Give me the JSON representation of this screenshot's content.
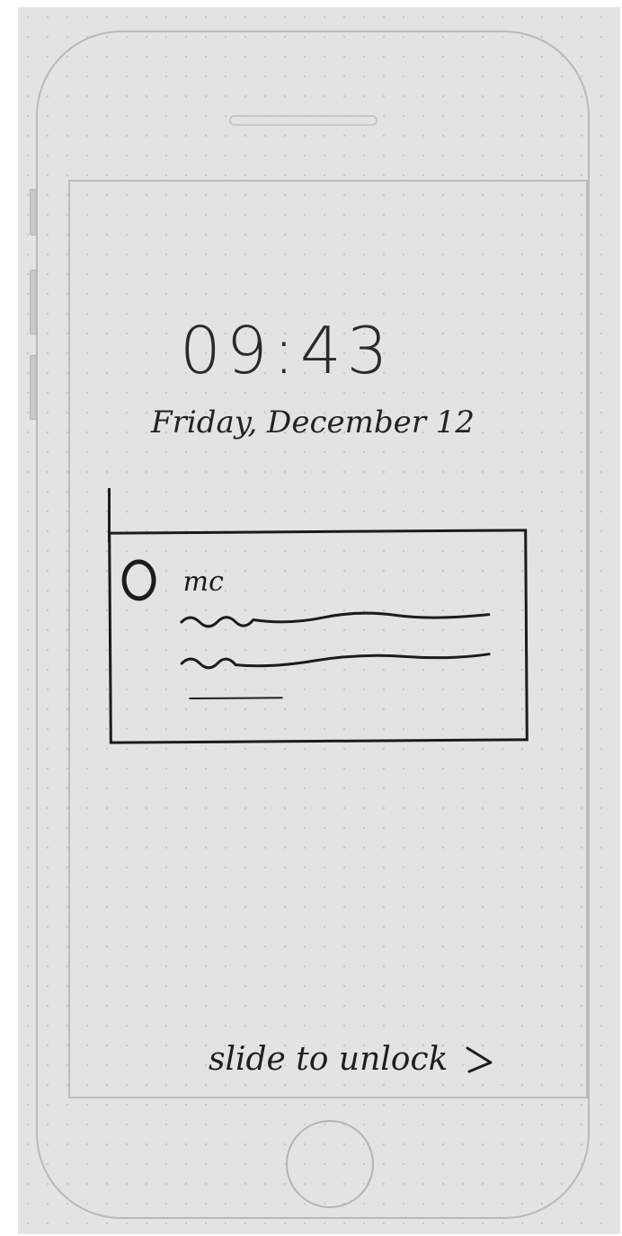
{
  "lock_screen": {
    "time": "09:43",
    "date": "Friday, December 12",
    "unlock_label": "slide to unlock",
    "unlock_icon": "chevron-right-icon"
  },
  "notification": {
    "sender": "mc",
    "avatar_icon": "circle-avatar-icon",
    "body_lines": [
      "scribble-line",
      "scribble-line",
      "short-line"
    ]
  },
  "colors": {
    "paper": "#e3e4e1",
    "ink": "#1c1c1c",
    "outline": "#b9bab6"
  }
}
